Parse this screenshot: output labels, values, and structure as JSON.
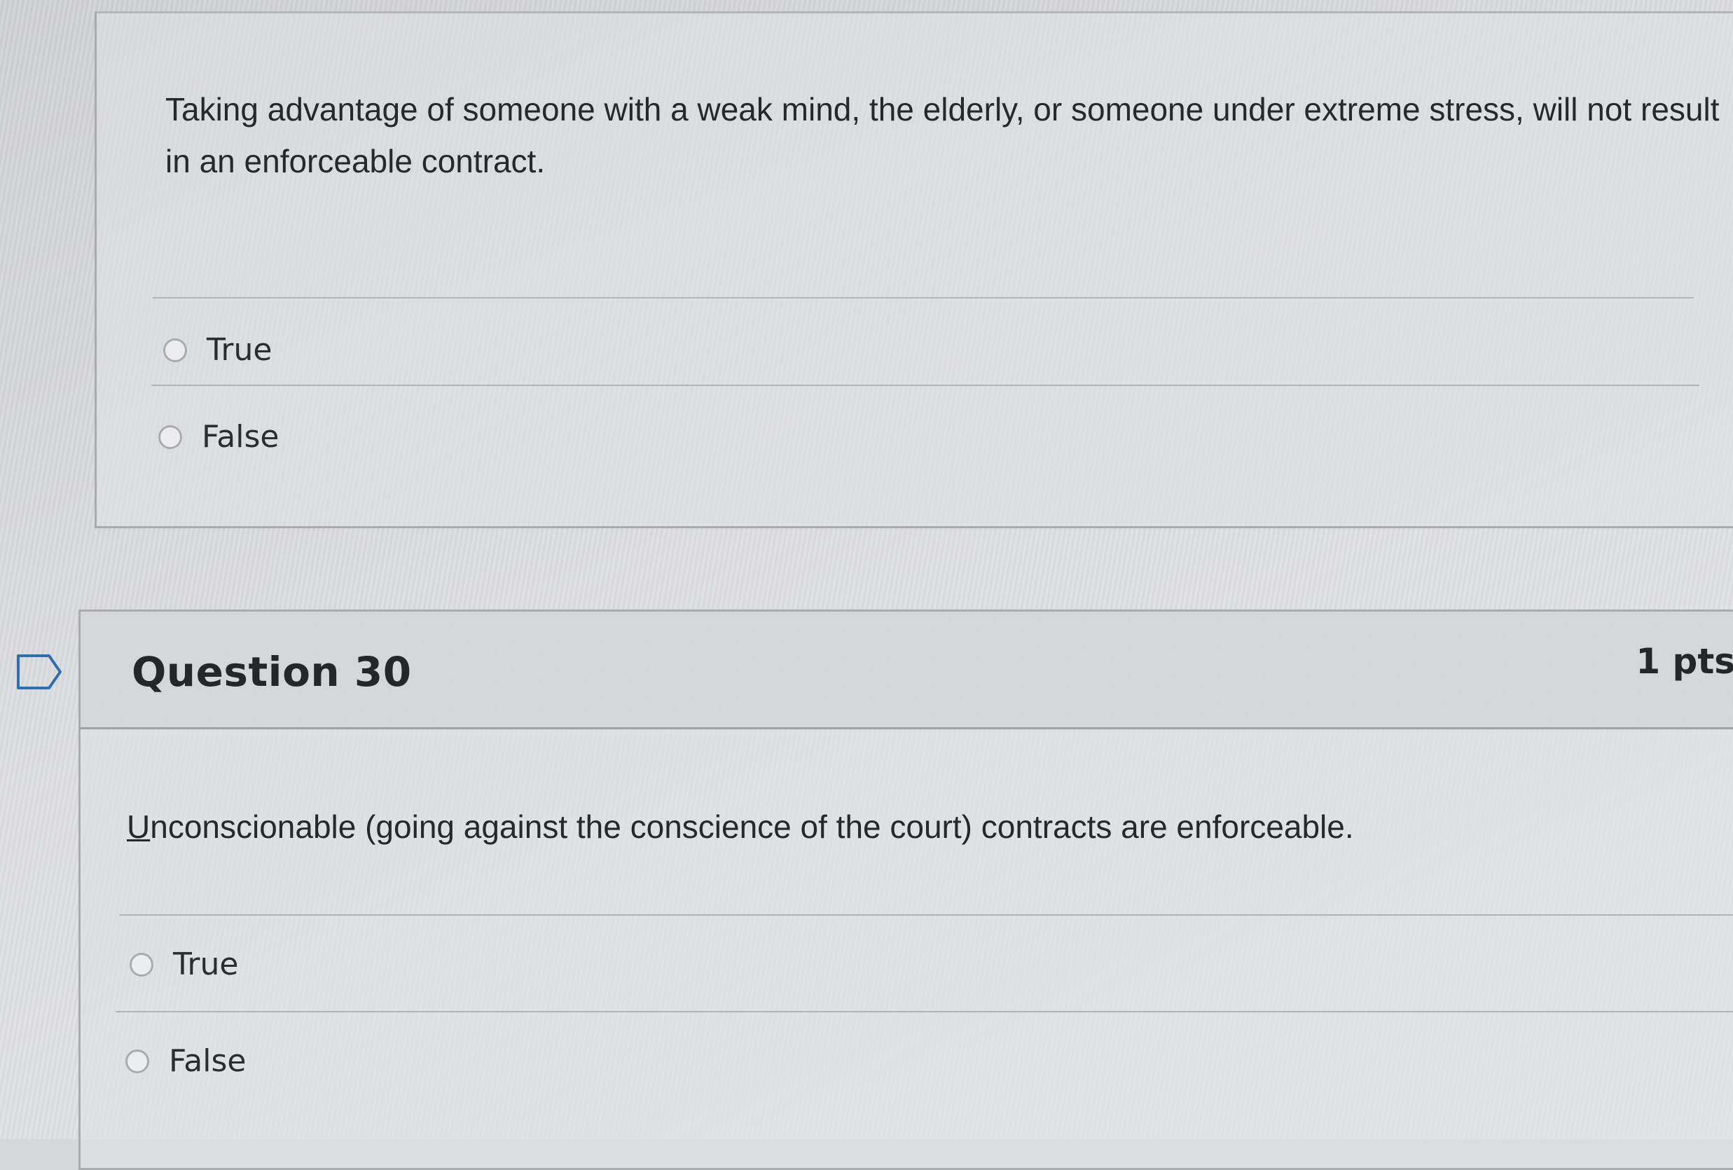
{
  "questions": [
    {
      "text": "Taking advantage of someone with a weak mind, the elderly, or someone under extreme stress, will not result in an enforceable contract.",
      "answers": [
        "True",
        "False"
      ]
    },
    {
      "title": "Question 30",
      "points": "1 pts",
      "text_first_letter": "U",
      "text_rest": "nconscionable (going against the conscience of the court) contracts are enforceable.",
      "answers": [
        "True",
        "False"
      ]
    }
  ],
  "icons": {
    "flag": "flag-question-icon",
    "radio": "radio-button-icon"
  },
  "colors": {
    "text": "#26282c",
    "border": "#a9abae"
  }
}
